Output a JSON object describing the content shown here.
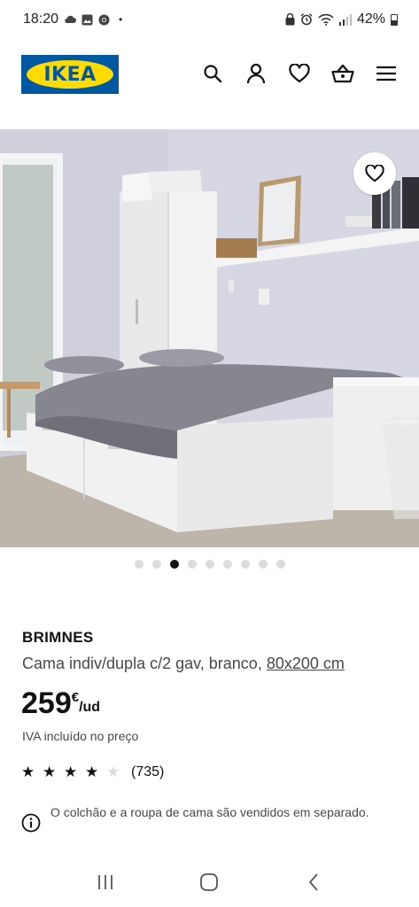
{
  "status_bar": {
    "time": "18:20",
    "dot": "•",
    "battery_text": "42%",
    "left_icons": [
      "cloud-icon",
      "gallery-icon",
      "chrome-icon"
    ],
    "right_icons": [
      "lock-icon",
      "alarm-icon",
      "wifi-icon",
      "signal-icon",
      "battery-icon"
    ]
  },
  "header": {
    "logo_text": "IKEA",
    "icons": [
      "search-icon",
      "user-icon",
      "heart-icon",
      "basket-icon",
      "menu-icon"
    ],
    "colors": {
      "brand_blue": "#0058a3",
      "brand_yellow": "#ffdb00"
    }
  },
  "gallery": {
    "image_count": 9,
    "active_index": 2
  },
  "product": {
    "name": "BRIMNES",
    "description": "Cama indiv/dupla c/2 gav, branco,",
    "size": "80x200 cm",
    "price_integer": "259",
    "price_currency": "€",
    "price_unit": "/ud",
    "vat_note": "IVA incluído no preço",
    "rating": 4,
    "rating_max": 5,
    "review_count": "(735)",
    "info_note": "O colchão e a roupa de cama são vendidos em separado."
  },
  "nav_bar": {
    "buttons": [
      "recent-apps-icon",
      "home-icon",
      "back-icon"
    ]
  }
}
